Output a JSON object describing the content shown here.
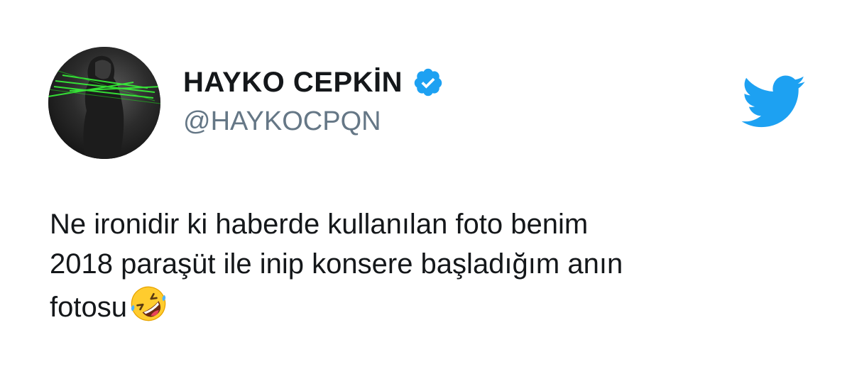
{
  "user": {
    "display_name": "HAYKO CEPKİN",
    "handle": "@HAYKOCPQN",
    "verified": true,
    "verified_icon": "verified-badge-icon"
  },
  "brand": {
    "logo_icon": "twitter-bird-icon",
    "color": "#1da1f2"
  },
  "tweet": {
    "lines": [
      "Ne ironidir ki haberde kullanılan foto benim",
      "2018 paraşüt ile inip konsere başladığım anın",
      "fotosu"
    ],
    "emoji": "rolling-on-the-floor-laughing-emoji"
  },
  "colors": {
    "text": "#14171a",
    "handle": "#657786",
    "accent": "#1da1f2"
  }
}
